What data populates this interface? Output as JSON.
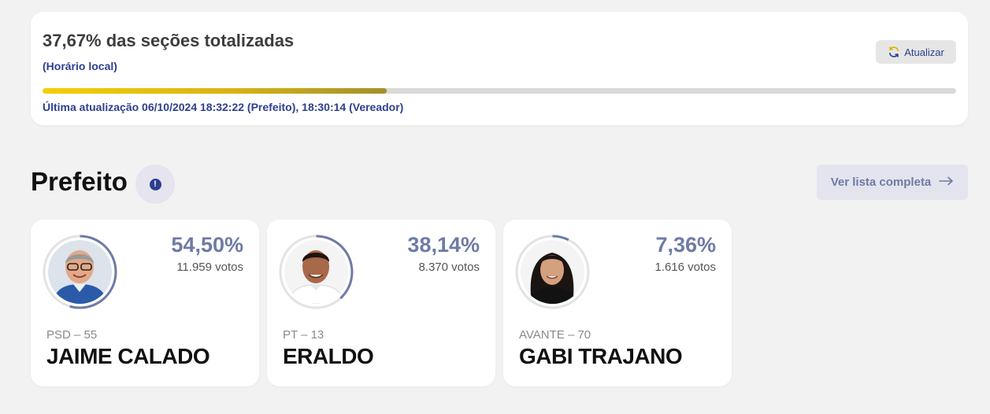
{
  "status": {
    "title": "37,67% das seções totalizadas",
    "subtitle": "(Horário local)",
    "refresh_label": "Atualizar",
    "progress_fraction": 0.3767,
    "last_update": "Última atualização 06/10/2024 18:32:22 (Prefeito), 18:30:14 (Vereador)"
  },
  "section": {
    "title": "Prefeito",
    "info_icon": "!",
    "full_list_label": "Ver lista completa",
    "full_list_icon": "→"
  },
  "candidates": [
    {
      "percent": "54,50%",
      "percent_value": 0.545,
      "votes": "11.959 votos",
      "party": "PSD – 55",
      "name": "JAIME CALADO"
    },
    {
      "percent": "38,14%",
      "percent_value": 0.3814,
      "votes": "8.370 votos",
      "party": "PT – 13",
      "name": "ERALDO"
    },
    {
      "percent": "7,36%",
      "percent_value": 0.0736,
      "votes": "1.616 votos",
      "party": "AVANTE – 70",
      "name": "GABI TRAJANO"
    }
  ],
  "colors": {
    "accent": "#2d3f8f",
    "muted_accent": "#6f7ba5",
    "progress_start": "#f2d000",
    "progress_end": "#a48f2a",
    "ring": "#6f7ba5",
    "ring_track": "#e3e3e3"
  }
}
